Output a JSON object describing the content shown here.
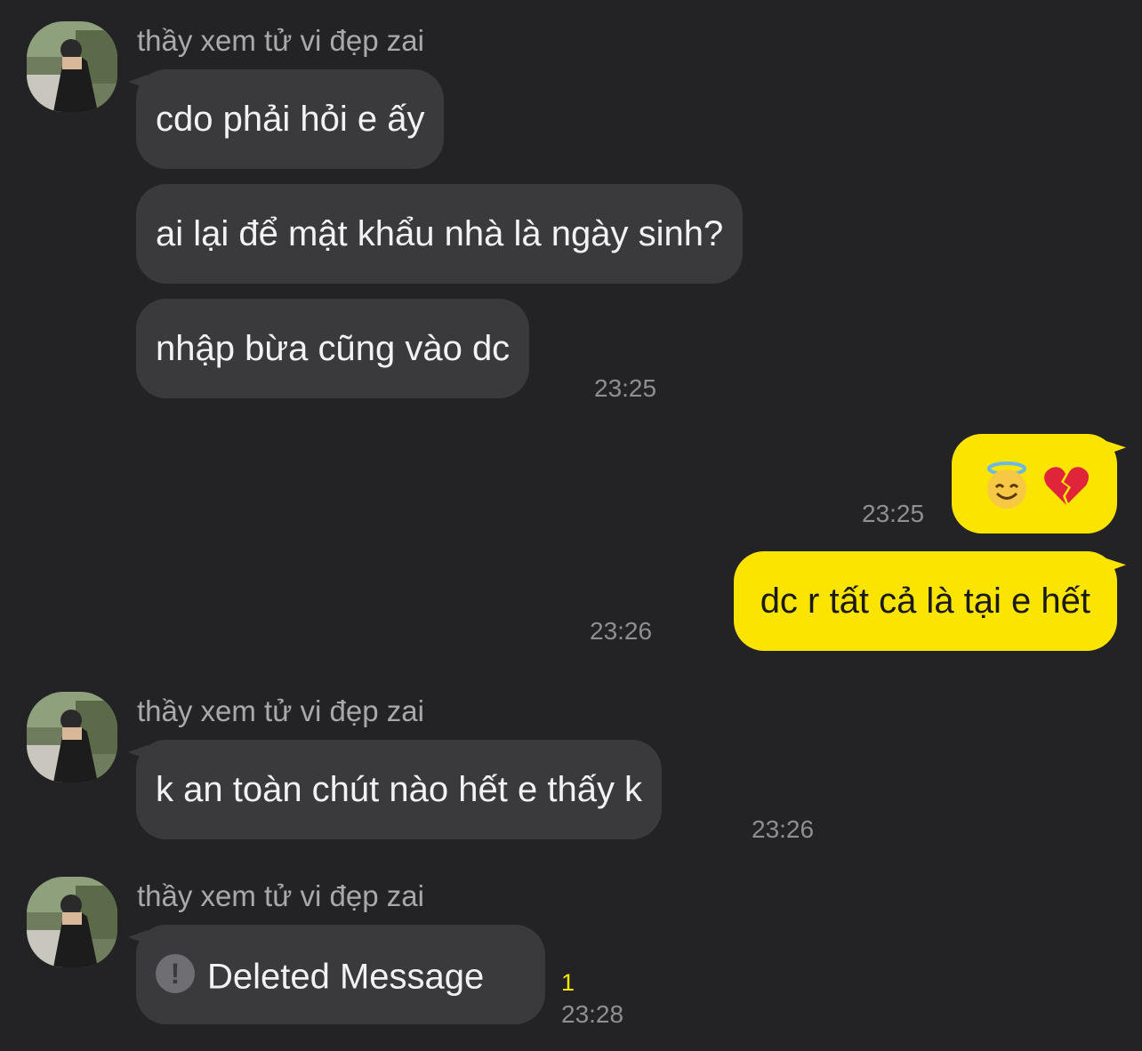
{
  "messages": {
    "group1": {
      "sender": "thầy xem tử vi đẹp zai",
      "lines": [
        "cdo phải hỏi e ấy",
        "ai lại để mật khẩu nhà là ngày sinh?",
        "nhập bừa cũng vào dc"
      ],
      "time": "23:25"
    },
    "out1": {
      "emojis": [
        "smiling-face-with-halo-icon",
        "broken-heart-icon"
      ],
      "time": "23:25"
    },
    "out2": {
      "text": "dc r tất cả là tại e hết",
      "time": "23:26"
    },
    "group2": {
      "sender": "thầy xem tử vi đẹp zai",
      "text": "k an toàn chút nào hết e thấy k",
      "time": "23:26"
    },
    "group3": {
      "sender": "thầy xem tử vi đẹp zai",
      "deleted_label": "Deleted Message",
      "alert_glyph": "!",
      "unread_count": "1",
      "time": "23:28"
    }
  },
  "colors": {
    "background": "#232325",
    "incoming_bubble": "#3a3a3c",
    "outgoing_bubble": "#fbe400",
    "unread": "#fbe400"
  }
}
